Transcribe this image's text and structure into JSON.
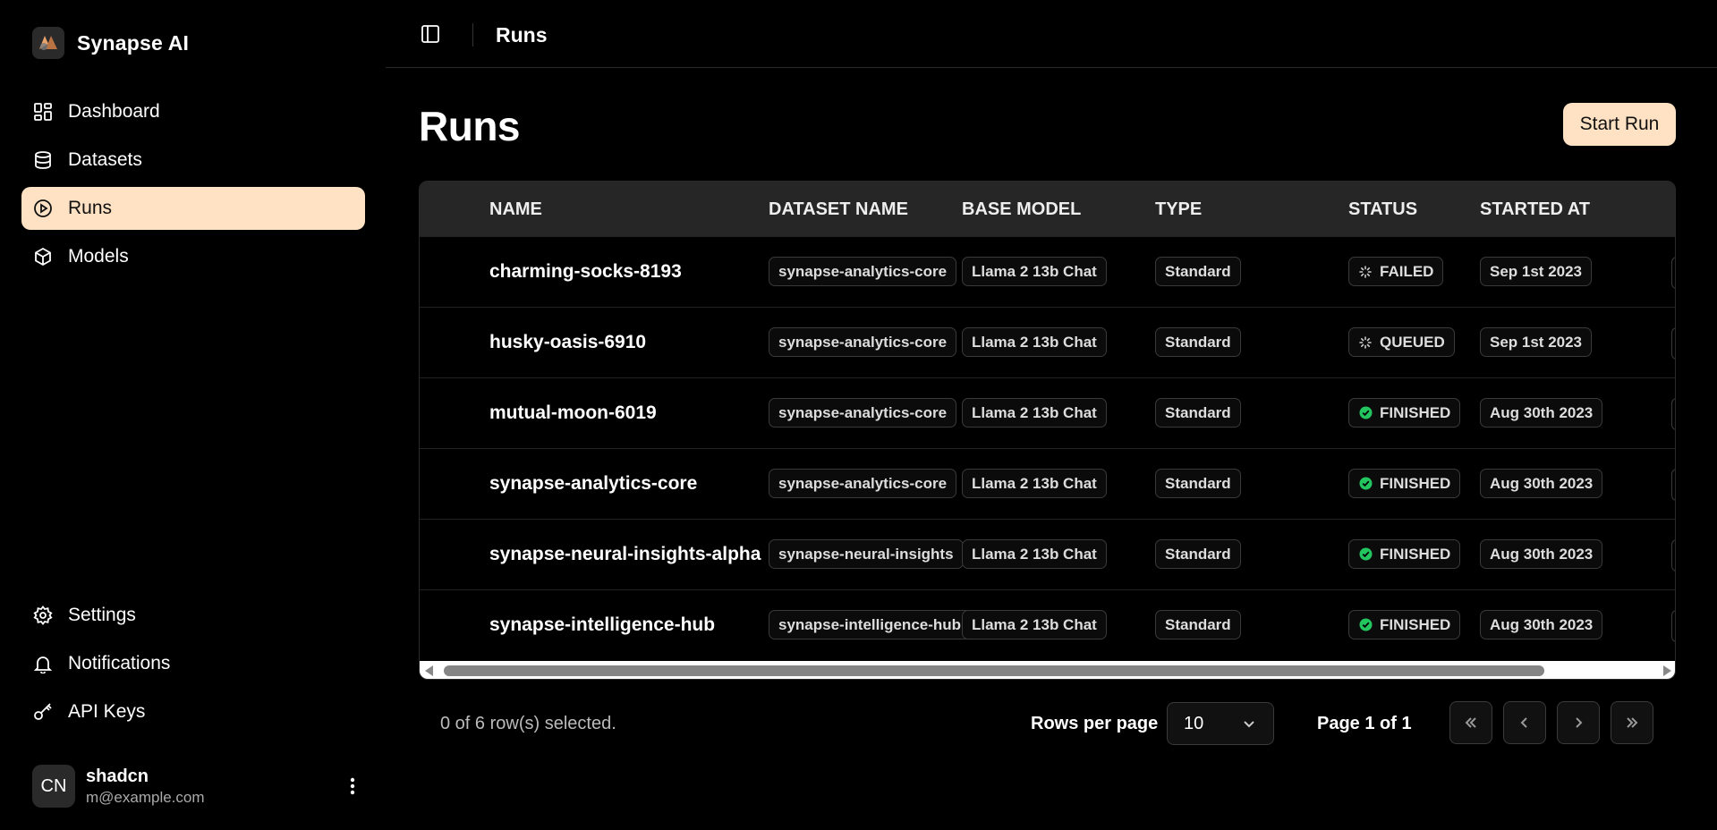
{
  "brand": {
    "name": "Synapse AI"
  },
  "sidebar": {
    "top_items": [
      {
        "label": "Dashboard",
        "icon": "dashboard-icon"
      },
      {
        "label": "Datasets",
        "icon": "database-icon"
      },
      {
        "label": "Runs",
        "icon": "play-circle-icon",
        "active": true
      },
      {
        "label": "Models",
        "icon": "cube-icon"
      }
    ],
    "bottom_items": [
      {
        "label": "Settings",
        "icon": "gear-icon"
      },
      {
        "label": "Notifications",
        "icon": "bell-icon"
      },
      {
        "label": "API Keys",
        "icon": "key-icon"
      }
    ],
    "user": {
      "initials": "CN",
      "name": "shadcn",
      "email": "m@example.com"
    }
  },
  "header": {
    "title": "Runs"
  },
  "main": {
    "title": "Runs",
    "start_button": "Start Run",
    "table": {
      "columns": [
        "NAME",
        "DATASET NAME",
        "BASE MODEL",
        "TYPE",
        "STATUS",
        "STARTED AT"
      ],
      "rows": [
        {
          "name": "charming-socks-8193",
          "dataset": "synapse-analytics-core",
          "model": "Llama 2 13b Chat",
          "type": "Standard",
          "status": "FAILED",
          "status_icon": "spinner-icon",
          "started": "Sep 1st 2023"
        },
        {
          "name": "husky-oasis-6910",
          "dataset": "synapse-analytics-core",
          "model": "Llama 2 13b Chat",
          "type": "Standard",
          "status": "QUEUED",
          "status_icon": "spinner-icon",
          "started": "Sep 1st 2023"
        },
        {
          "name": "mutual-moon-6019",
          "dataset": "synapse-analytics-core",
          "model": "Llama 2 13b Chat",
          "type": "Standard",
          "status": "FINISHED",
          "status_icon": "check-circle-icon",
          "started": "Aug 30th 2023"
        },
        {
          "name": "synapse-analytics-core",
          "dataset": "synapse-analytics-core",
          "model": "Llama 2 13b Chat",
          "type": "Standard",
          "status": "FINISHED",
          "status_icon": "check-circle-icon",
          "started": "Aug 30th 2023"
        },
        {
          "name": "synapse-neural-insights-alpha",
          "dataset": "synapse-neural-insights",
          "model": "Llama 2 13b Chat",
          "type": "Standard",
          "status": "FINISHED",
          "status_icon": "check-circle-icon",
          "started": "Aug 30th 2023"
        },
        {
          "name": "synapse-intelligence-hub",
          "dataset": "synapse-intelligence-hub",
          "model": "Llama 2 13b Chat",
          "type": "Standard",
          "status": "FINISHED",
          "status_icon": "check-circle-icon",
          "started": "Aug 30th 2023"
        }
      ]
    },
    "footer": {
      "selection": "0 of 6 row(s) selected.",
      "rows_per_page_label": "Rows per page",
      "rows_per_page_value": "10",
      "page_info": "Page 1 of 1"
    }
  },
  "colors": {
    "accent": "#ffe1c3",
    "success": "#22c55e"
  }
}
